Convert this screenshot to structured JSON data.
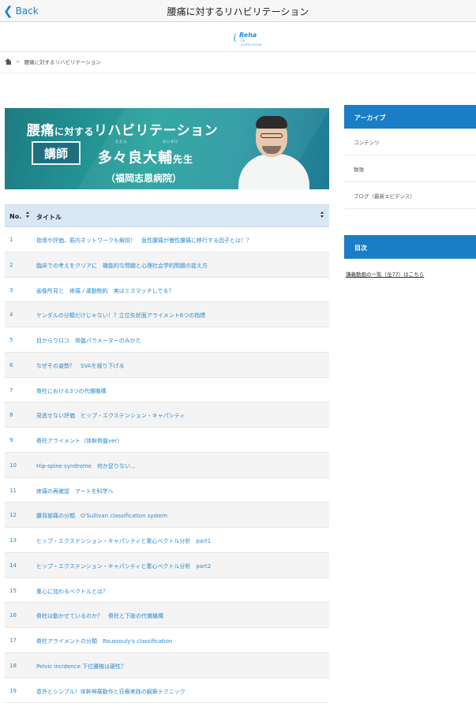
{
  "navbar": {
    "back_label": "Back",
    "title": "腰痛に対するリハビリテーション"
  },
  "logo": {
    "brand": "Reha",
    "sub": "for professional"
  },
  "breadcrumb": {
    "current": "腰痛に対するリハビリテーション"
  },
  "banner": {
    "title_main": "腰痛",
    "title_small": "に対する",
    "title_rest": "リハビリテーション",
    "role": "講師",
    "ruby_family": "たたら",
    "ruby_given": "だいすけ",
    "name": "多々良大輔",
    "honorific": "先生",
    "hospital": "（福岡志恩病院）"
  },
  "table": {
    "headers": {
      "no": "No.",
      "title": "タイトル"
    },
    "rows": [
      {
        "no": "1",
        "title": "指導や評価、筋内ネットワークも解説！　急性腰痛が慢性腰痛に移行する因子とは！？"
      },
      {
        "no": "2",
        "title": "臨床での考えをクリアに　機能的な問題と心理社会学的問題の捉え方"
      },
      {
        "no": "3",
        "title": "画像所見と　疼痛 / 運動制約　実はミスマッチしてる？"
      },
      {
        "no": "4",
        "title": "ケンダルの分類だけじゃない！？立位矢状面アライメント6つの指標"
      },
      {
        "no": "5",
        "title": "目からウロコ　骨盤パラメーターのみかた"
      },
      {
        "no": "6",
        "title": "なぜその姿勢？　SVAを掘り下げる"
      },
      {
        "no": "7",
        "title": "脊柱における3つの代償機構"
      },
      {
        "no": "8",
        "title": "見逃せない評価　ヒップ・エクステンション・キャパシティ"
      },
      {
        "no": "9",
        "title": "脊柱アライメント（体幹骨盤ver）"
      },
      {
        "no": "10",
        "title": "Hip-spine syndrome　何か足りない..."
      },
      {
        "no": "11",
        "title": "疼痛の再確認　アートを科学へ"
      },
      {
        "no": "12",
        "title": "腰背部痛の分類　O'Sullivan classification system"
      },
      {
        "no": "13",
        "title": "ヒップ・エクステンション・キャパシティと重心ベクトル分析　part1"
      },
      {
        "no": "14",
        "title": "ヒップ・エクステンション・キャパシティと重心ベクトル分析　part2"
      },
      {
        "no": "15",
        "title": "重心に加わるベクトルとは？"
      },
      {
        "no": "16",
        "title": "脊柱は動かせているのか？　脊柱と下肢の代償機構"
      },
      {
        "no": "17",
        "title": "脊柱アライメントの分類　Roussouly's classification"
      },
      {
        "no": "18",
        "title": "Pelvic incidence 下位腰椎は硬性？"
      },
      {
        "no": "19",
        "title": "意外とシンプル！体幹伸展動作と荘療実践の観察テクニック"
      }
    ]
  },
  "sidebar": {
    "archive_title": "アーカイブ",
    "archive_items": [
      "コンテンツ",
      "勉強",
      "ブログ（最新エビデンス）"
    ],
    "toc_title": "目次",
    "toc_link": "講義動画の一覧（全77）はこちら"
  }
}
